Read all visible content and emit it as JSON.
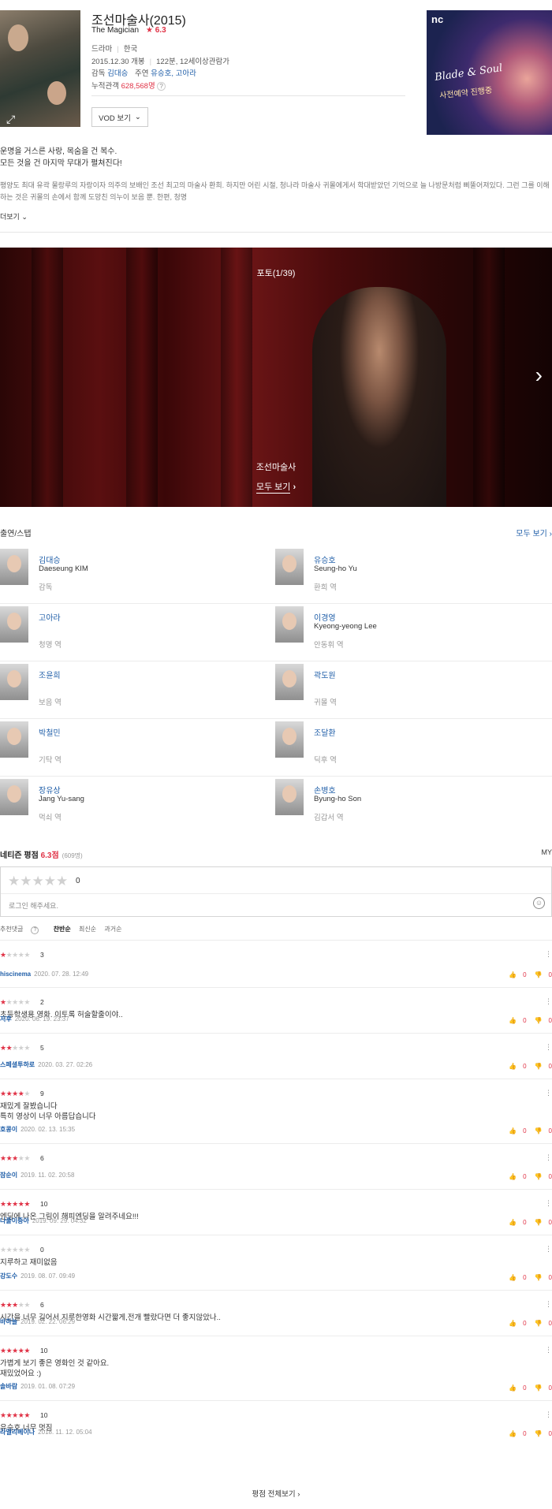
{
  "movie": {
    "title": "조선마술사(2015)",
    "english_title": "The Magician",
    "rating": "★ 6.3",
    "genre": "드라마",
    "country": "한국",
    "release": "2015.12.30 개봉",
    "runtime_rating": "122분, 12세이상관람가",
    "director_label": "감독",
    "director": "김대승",
    "cast_label": "주연",
    "lead_cast": "유승호, 고아라",
    "audience_label": "누적관객",
    "audience": "628,568명",
    "vod_button": "VOD 보기"
  },
  "ad": {
    "brand": "nc",
    "game": "Blade & Soul",
    "tagline": "사전예약 진행중"
  },
  "synopsis": {
    "line1": "운명을 거스른 사랑, 목숨을 건 복수.",
    "line2": "모든 것을 건 마지막 무대가 펼쳐진다!",
    "body": "평양도 최대 유곽 물랑루의 자랑이자 의주의 보배인 조선 최고의 마술사 환희. 하지만 어린 시절, 청나라 마술사 귀몰에게서 학대받았던 기억으로 늘 나방문처럼 삐뚤어져있다. 그런 그를 이해하는 것은 귀몰의 손에서 함께 도망친 의누이 보음 뿐. 한편, 청명",
    "more": "더보기"
  },
  "photo": {
    "counter": "포토(1/39)",
    "caption": "조선마술사",
    "view_all": "모두 보기"
  },
  "cast_section": {
    "title": "출연/스탭",
    "view_all": "모두 보기",
    "people": [
      {
        "name": "김대승",
        "english": "Daeseung KIM",
        "role": "감독"
      },
      {
        "name": "유승호",
        "english": "Seung-ho Yu",
        "role": "환희 역"
      },
      {
        "name": "고아라",
        "english": "",
        "role": "청명 역"
      },
      {
        "name": "이경영",
        "english": "Kyeong-yeong Lee",
        "role": "안동휘 역"
      },
      {
        "name": "조윤희",
        "english": "",
        "role": "보음 역"
      },
      {
        "name": "곽도원",
        "english": "",
        "role": "귀몰 역"
      },
      {
        "name": "박철민",
        "english": "",
        "role": "기탁 역"
      },
      {
        "name": "조달환",
        "english": "",
        "role": "딕후 역"
      },
      {
        "name": "장유상",
        "english": "Jang Yu-sang",
        "role": "먹쇠 역"
      },
      {
        "name": "손병호",
        "english": "Byung-ho Son",
        "role": "김갑서 역"
      }
    ]
  },
  "ratings": {
    "title": "네티즌 평점",
    "score": "6.3점",
    "count": "(609명)",
    "my": "MY",
    "input_stars": "★★★★★",
    "input_score": "0",
    "placeholder": "로그인 해주세요.",
    "sort_label": "추천댓글",
    "sort_help": "?",
    "sorts": [
      "찬반순",
      "최신순",
      "과거순"
    ],
    "reviews": [
      {
        "stars_on": 1,
        "score": "3",
        "comment": "",
        "author": "hiscinema",
        "date": "2020. 07. 28. 12:49",
        "up": "0",
        "down": "0"
      },
      {
        "stars_on": 1,
        "score": "2",
        "comment": "초등학생용 영화. 이토록 허술할줄이야..",
        "author": "저후",
        "date": "2020. 06. 19. 23:37",
        "up": "0",
        "down": "0"
      },
      {
        "stars_on": 2,
        "score": "5",
        "comment": "",
        "author": "스페셜투하로",
        "date": "2020. 03. 27. 02:26",
        "up": "0",
        "down": "0"
      },
      {
        "stars_on": 4,
        "score": "9",
        "comment": "재밌게 잘봤습니다\n특히 영상이 너무 아름답습니다",
        "author": "호콩이",
        "date": "2020. 02. 13. 15:35",
        "up": "0",
        "down": "0"
      },
      {
        "stars_on": 3,
        "score": "6",
        "comment": "",
        "author": "잠순이",
        "date": "2019. 11. 02. 20:58",
        "up": "0",
        "down": "0"
      },
      {
        "stars_on": 5,
        "score": "10",
        "comment": "엔딩에 나온 그림이 해피엔딩을 알려주네요!!!",
        "author": "나풀이중아",
        "date": "2019. 09. 29. 04:32",
        "up": "0",
        "down": "0"
      },
      {
        "stars_on": 0,
        "score": "0",
        "comment": "지루하고 재미없음",
        "author": "강도수",
        "date": "2019. 08. 07. 09:49",
        "up": "0",
        "down": "0"
      },
      {
        "stars_on": 3,
        "score": "6",
        "comment": "시간을 너무 길어서 지루한영화 시간짧게,전개 빨랐다면 더 좋지않았나..",
        "author": "바하늘",
        "date": "2019. 02. 22. 06:29",
        "up": "0",
        "down": "0"
      },
      {
        "stars_on": 5,
        "score": "10",
        "comment": "가볍게 보기 좋은 영화인 것 같아요.\n재밌었어요 :)",
        "author": "솔바람",
        "date": "2019. 01. 08. 07:29",
        "up": "0",
        "down": "0"
      },
      {
        "stars_on": 5,
        "score": "10",
        "comment": "유승호 너무 멋짐",
        "author": "라엘리베이나",
        "date": "2018. 11. 12. 05:04",
        "up": "0",
        "down": "0"
      }
    ],
    "all_reviews": "평점 전체보기"
  }
}
